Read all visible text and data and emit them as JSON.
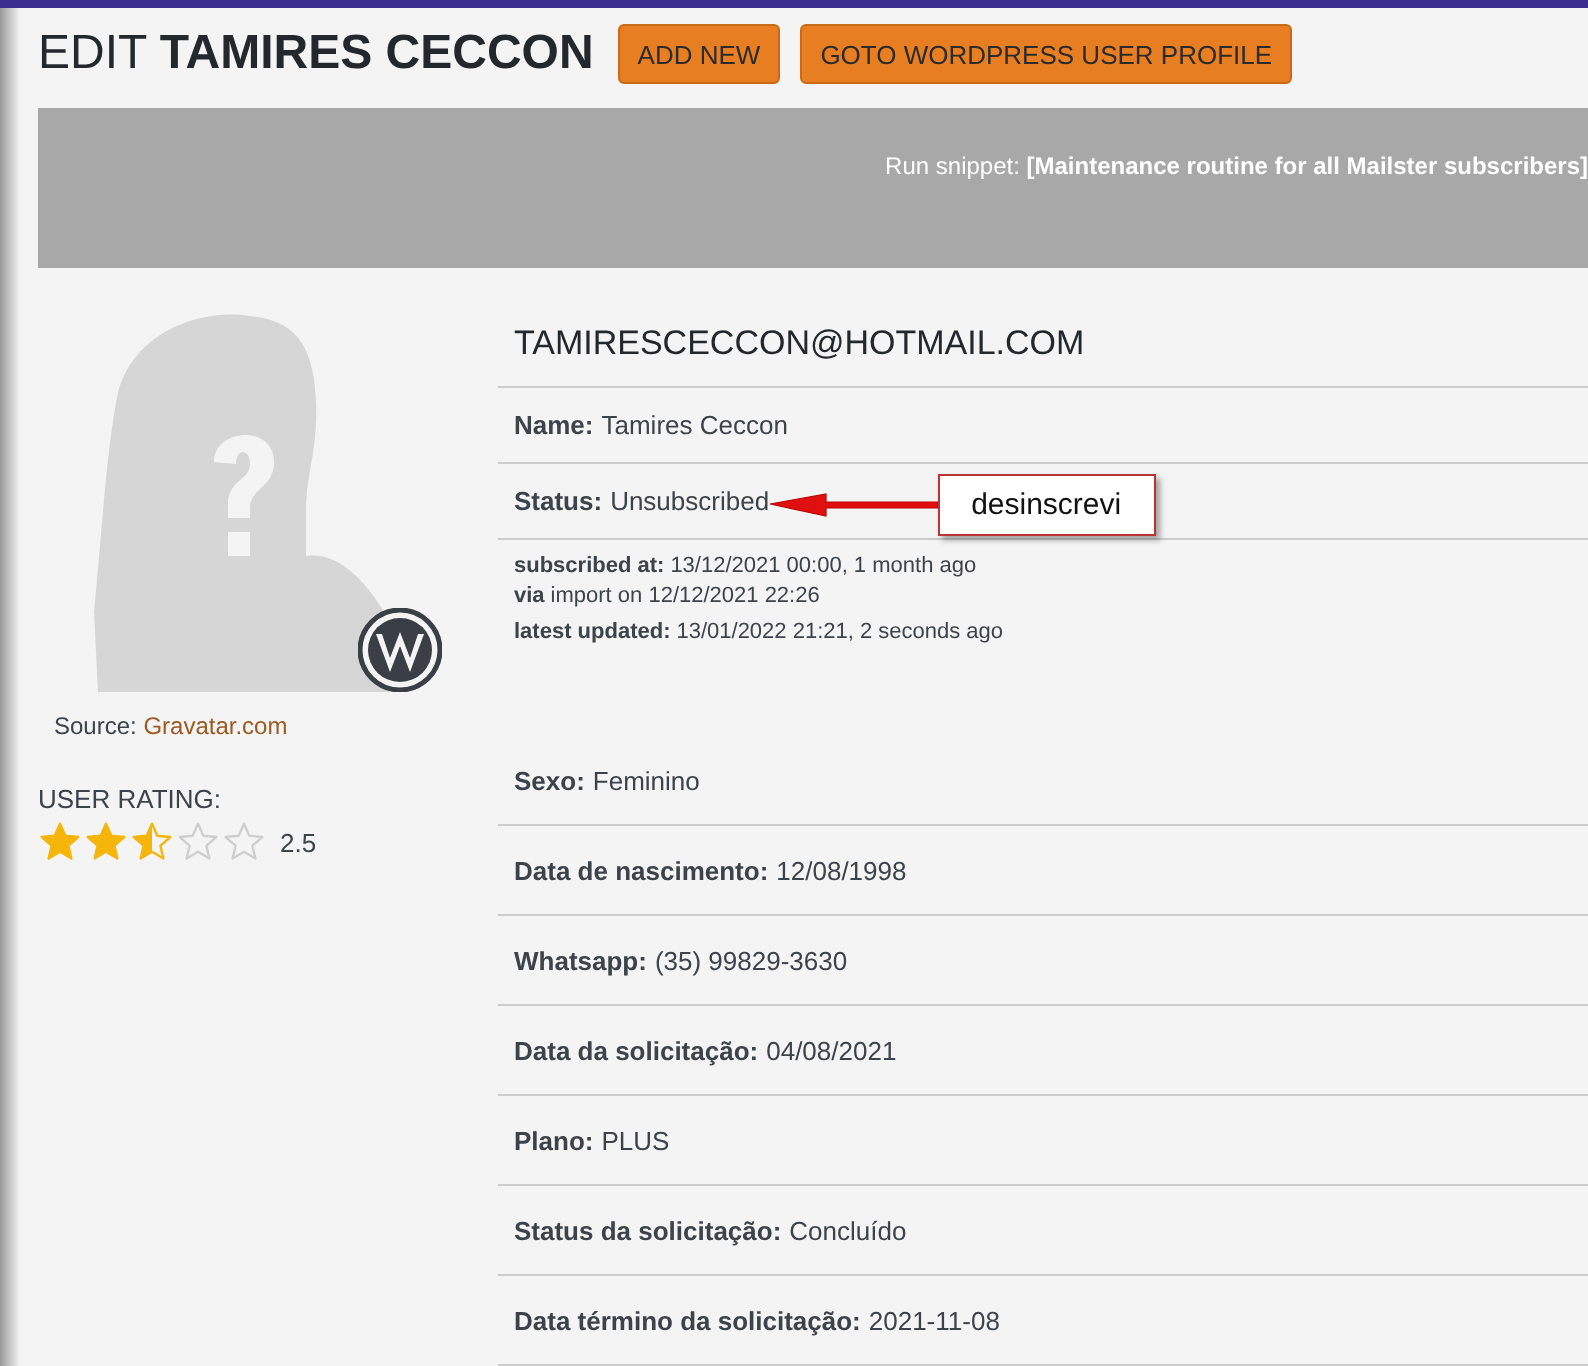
{
  "page_title": {
    "prefix": "EDIT",
    "name": "TAMIRES CECCON"
  },
  "buttons": [
    "ADD NEW",
    "GOTO WORDPRESS USER PROFILE"
  ],
  "banner": {
    "label": "Run snippet:",
    "snippet": "[Maintenance routine for all Mailster subscribers]"
  },
  "avatar": {
    "source_label": "Source:",
    "source_link": "Gravatar.com"
  },
  "rating": {
    "label": "USER RATING:",
    "stars": 2.5,
    "value": "2.5"
  },
  "email": "TAMIRESCECCON@HOTMAIL.COM",
  "fields": [
    {
      "label": "Name:",
      "value": "Tamires Ceccon"
    },
    {
      "label": "Status:",
      "value": "Unsubscribed",
      "annotation": "desinscrevi"
    }
  ],
  "details": [
    {
      "label": "subscribed at:",
      "value": "13/12/2021 00:00, 1 month ago"
    },
    {
      "label": "via",
      "value": "import on 12/12/2021 22:26"
    },
    {
      "label": "latest updated:",
      "value": "13/01/2022 21:21, 2 seconds ago"
    }
  ],
  "custom_fields": [
    {
      "label": "Sexo:",
      "value": "Feminino"
    },
    {
      "label": "Data de nascimento:",
      "value": "12/08/1998"
    },
    {
      "label": "Whatsapp:",
      "value": "(35) 99829-3630"
    },
    {
      "label": "Data da solicitação:",
      "value": "04/08/2021"
    },
    {
      "label": "Plano:",
      "value": "PLUS"
    },
    {
      "label": "Status da solicitação:",
      "value": "Concluído"
    },
    {
      "label": "Data término da solicitação:",
      "value": "2021-11-08"
    }
  ]
}
